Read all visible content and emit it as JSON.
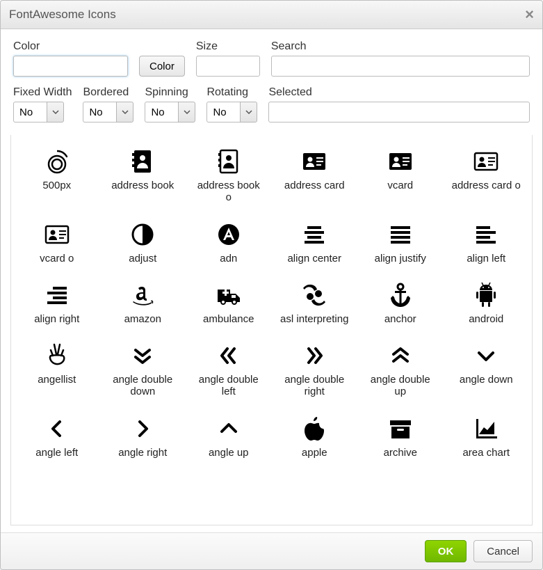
{
  "dialog": {
    "title": "FontAwesome Icons",
    "close_glyph": "×"
  },
  "form": {
    "row1": {
      "color_label": "Color",
      "color_value": "",
      "color_button": "Color",
      "size_label": "Size",
      "size_value": "",
      "search_label": "Search",
      "search_value": ""
    },
    "row2": {
      "fixed_width_label": "Fixed Width",
      "fixed_width_value": "No",
      "bordered_label": "Bordered",
      "bordered_value": "No",
      "spinning_label": "Spinning",
      "spinning_value": "No",
      "rotating_label": "Rotating",
      "rotating_value": "No",
      "selected_label": "Selected",
      "selected_value": ""
    }
  },
  "icons": [
    {
      "key": "500px",
      "label": "500px"
    },
    {
      "key": "address-book",
      "label": "address book"
    },
    {
      "key": "address-book-o",
      "label": "address book o"
    },
    {
      "key": "address-card",
      "label": "address card"
    },
    {
      "key": "vcard",
      "label": "vcard"
    },
    {
      "key": "address-card-o",
      "label": "address card o"
    },
    {
      "key": "vcard-o",
      "label": "vcard o"
    },
    {
      "key": "adjust",
      "label": "adjust"
    },
    {
      "key": "adn",
      "label": "adn"
    },
    {
      "key": "align-center",
      "label": "align center"
    },
    {
      "key": "align-justify",
      "label": "align justify"
    },
    {
      "key": "align-left",
      "label": "align left"
    },
    {
      "key": "align-right",
      "label": "align right"
    },
    {
      "key": "amazon",
      "label": "amazon"
    },
    {
      "key": "ambulance",
      "label": "ambulance"
    },
    {
      "key": "asl-interpreting",
      "label": "asl interpreting"
    },
    {
      "key": "anchor",
      "label": "anchor"
    },
    {
      "key": "android",
      "label": "android"
    },
    {
      "key": "angellist",
      "label": "angellist"
    },
    {
      "key": "angle-double-down",
      "label": "angle double down"
    },
    {
      "key": "angle-double-left",
      "label": "angle double left"
    },
    {
      "key": "angle-double-right",
      "label": "angle double right"
    },
    {
      "key": "angle-double-up",
      "label": "angle double up"
    },
    {
      "key": "angle-down",
      "label": "angle down"
    },
    {
      "key": "angle-left",
      "label": "angle left"
    },
    {
      "key": "angle-right",
      "label": "angle right"
    },
    {
      "key": "angle-up",
      "label": "angle up"
    },
    {
      "key": "apple",
      "label": "apple"
    },
    {
      "key": "archive",
      "label": "archive"
    },
    {
      "key": "area-chart",
      "label": "area chart"
    }
  ],
  "footer": {
    "ok": "OK",
    "cancel": "Cancel"
  }
}
